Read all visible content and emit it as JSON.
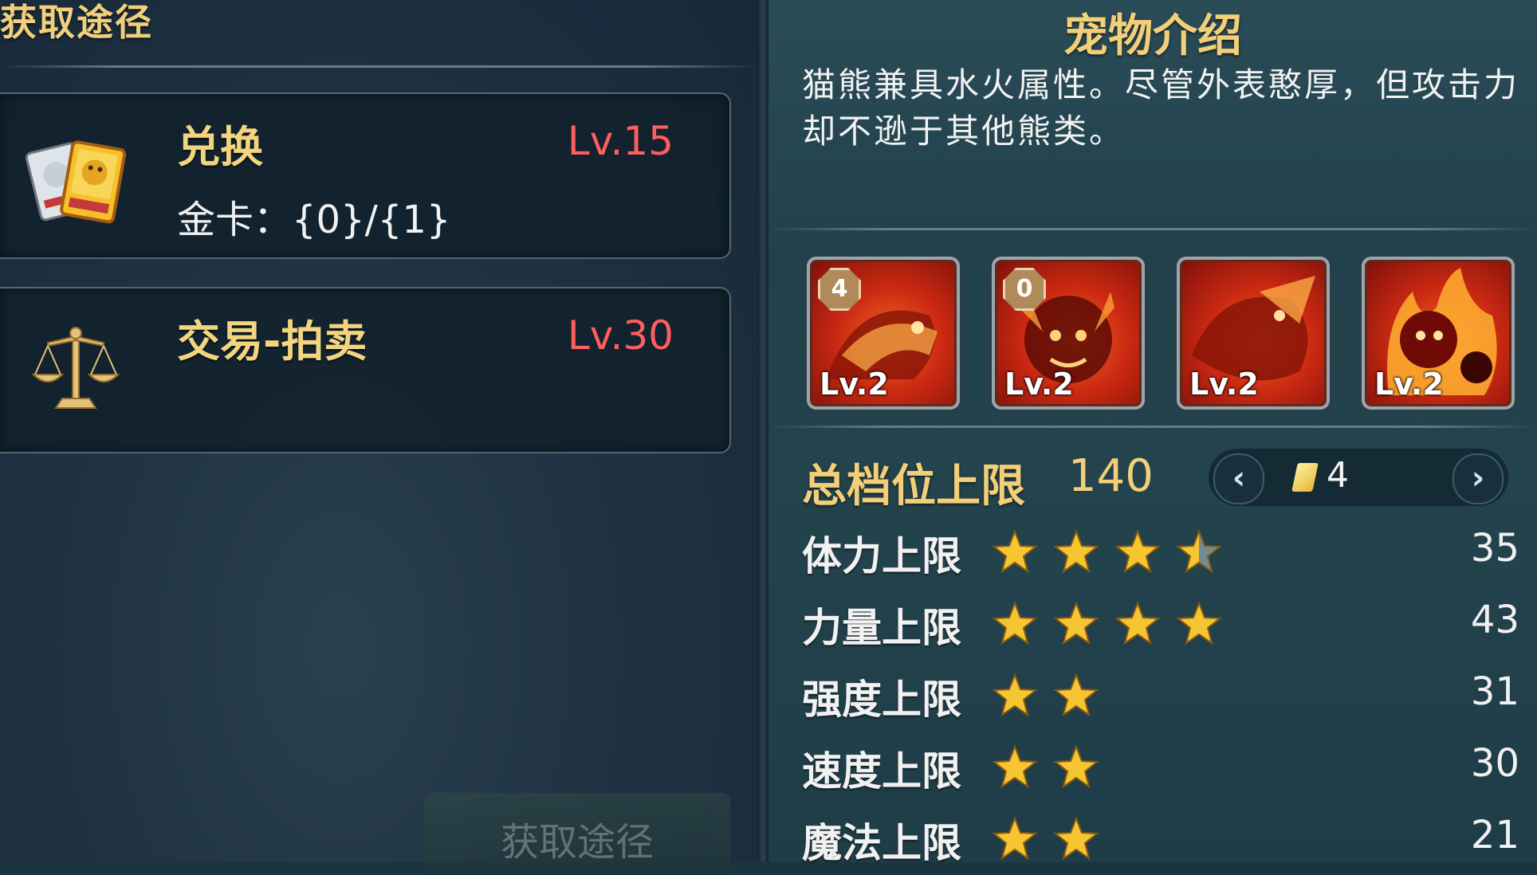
{
  "left": {
    "section_title": "获取途径",
    "sources": [
      {
        "title": "兑换",
        "level": "Lv.15",
        "subtitle": "金卡：{0}/{1}",
        "icon": "gold-card-icon"
      },
      {
        "title": "交易-拍卖",
        "level": "Lv.30",
        "icon": "scales-icon"
      }
    ],
    "bottom_button": "获取途径"
  },
  "right": {
    "title": "宠物介绍",
    "description": "猫熊兼具水火属性。尽管外表憨厚，但攻击力却不逊于其他熊类。",
    "skills": [
      {
        "level": "Lv.2",
        "badge": "4",
        "icon": "fire-bear-dash-icon"
      },
      {
        "level": "Lv.2",
        "badge": "0",
        "icon": "fire-bear-roar-icon"
      },
      {
        "level": "Lv.2",
        "badge": "",
        "icon": "fire-bear-charge-icon"
      },
      {
        "level": "Lv.2",
        "badge": "",
        "icon": "fire-bear-flame-icon"
      }
    ],
    "total_cap_label": "总档位上限",
    "total_cap_value": "140",
    "pager": {
      "value": "4",
      "prev": "‹",
      "next": "›"
    },
    "stats": [
      {
        "label": "体力上限",
        "stars": 3.5,
        "value": "35"
      },
      {
        "label": "力量上限",
        "stars": 4,
        "value": "43"
      },
      {
        "label": "强度上限",
        "stars": 2,
        "value": "31"
      },
      {
        "label": "速度上限",
        "stars": 2,
        "value": "30"
      },
      {
        "label": "魔法上限",
        "stars": 2,
        "value": "21"
      }
    ]
  },
  "colors": {
    "gold_text": "#f2cf78",
    "level_red": "#ff5e5e",
    "star": "#f6c632"
  }
}
